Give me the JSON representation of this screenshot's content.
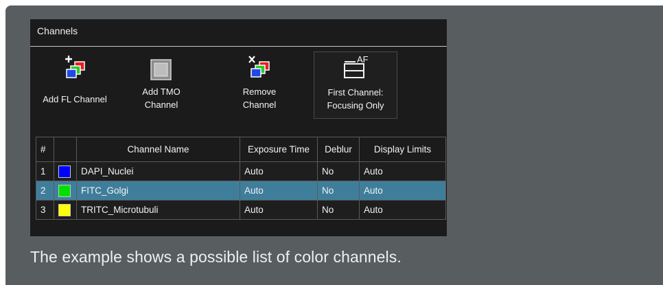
{
  "panel": {
    "title": "Channels"
  },
  "toolbar": {
    "add_fl": "Add FL Channel",
    "add_tmo": "Add TMO\nChannel",
    "remove": "Remove\nChannel",
    "first_channel": "First Channel:\nFocusing Only",
    "af_badge": "AF"
  },
  "table": {
    "headers": [
      "#",
      "",
      "Channel Name",
      "Exposure Time",
      "Deblur",
      "Display Limits"
    ],
    "rows": [
      {
        "num": "1",
        "color": "#0000ff",
        "name": "DAPI_Nuclei",
        "exposure": "Auto",
        "deblur": "No",
        "limits": "Auto",
        "selected": false
      },
      {
        "num": "2",
        "color": "#00e000",
        "name": "FITC_Golgi",
        "exposure": "Auto",
        "deblur": "No",
        "limits": "Auto",
        "selected": true
      },
      {
        "num": "3",
        "color": "#ffff00",
        "name": "TRITC_Microtubuli",
        "exposure": "Auto",
        "deblur": "No",
        "limits": "Auto",
        "selected": false
      }
    ]
  },
  "caption": "The example shows a possible list of color channels."
}
